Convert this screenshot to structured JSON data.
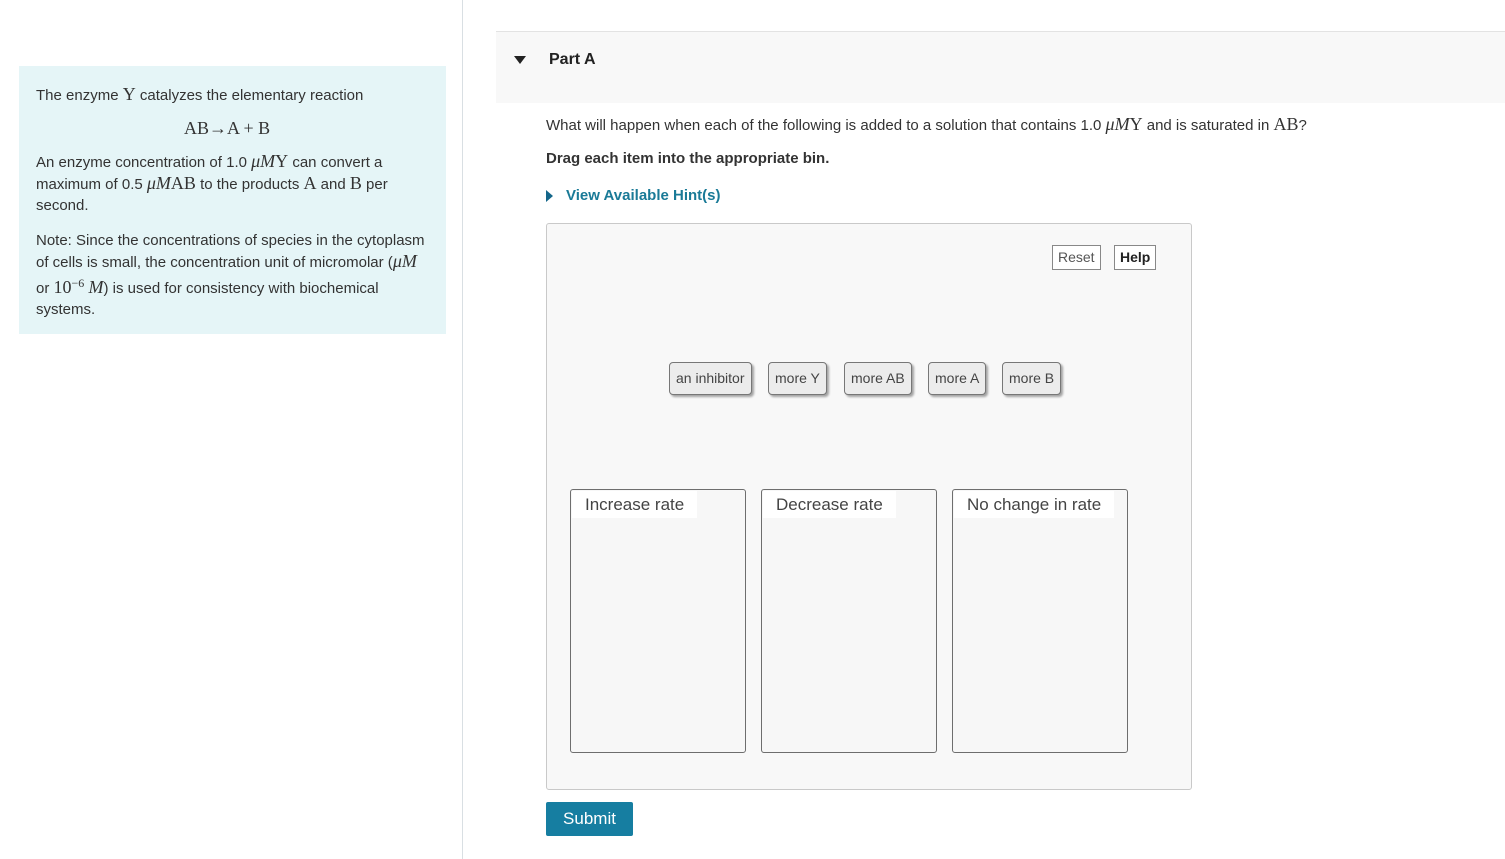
{
  "intro": {
    "line1_pre": "The enzyme ",
    "line1_sym": "Y",
    "line1_post": " catalyzes the elementary reaction",
    "equation": "AB→A + B",
    "p2_a": "An enzyme concentration of 1.0 ",
    "p2_unit1": "μM",
    "p2_sym1": "Y",
    "p2_b": " can convert a maximum of 0.5 ",
    "p2_unit2": "μM",
    "p2_sym2": "AB",
    "p2_c": " to the products ",
    "p2_sym3": "A",
    "p2_d": " and ",
    "p2_sym4": "B",
    "p2_e": " per second.",
    "note_a": "Note: Since the concentrations of species in the cytoplasm of cells is small,  the concentration unit of micromolar (",
    "note_unit": "μM",
    "note_b": " or ",
    "note_pow": "10",
    "note_exp": "−6",
    "note_M": "M",
    "note_c": ") is used for consistency with biochemical systems."
  },
  "part": {
    "title": "Part A"
  },
  "question": {
    "pre": "What will happen when each of the following is added to a solution that contains 1.0 ",
    "unit": "μM",
    "sym": "Y",
    "mid": " and is saturated in ",
    "sym2": "AB",
    "post": "?"
  },
  "instruction": "Drag each item into the appropriate bin.",
  "hints_label": "View Available Hint(s)",
  "toolbar": {
    "reset": "Reset",
    "help": "Help"
  },
  "items": [
    "an inhibitor",
    "more Y",
    "more AB",
    "more A",
    "more B"
  ],
  "bins": [
    "Increase rate",
    "Decrease rate",
    "No change in rate"
  ],
  "submit": "Submit",
  "colors": {
    "intro_bg": "#e5f5f7",
    "link": "#1a7a97",
    "submit_bg": "#167ea1"
  }
}
